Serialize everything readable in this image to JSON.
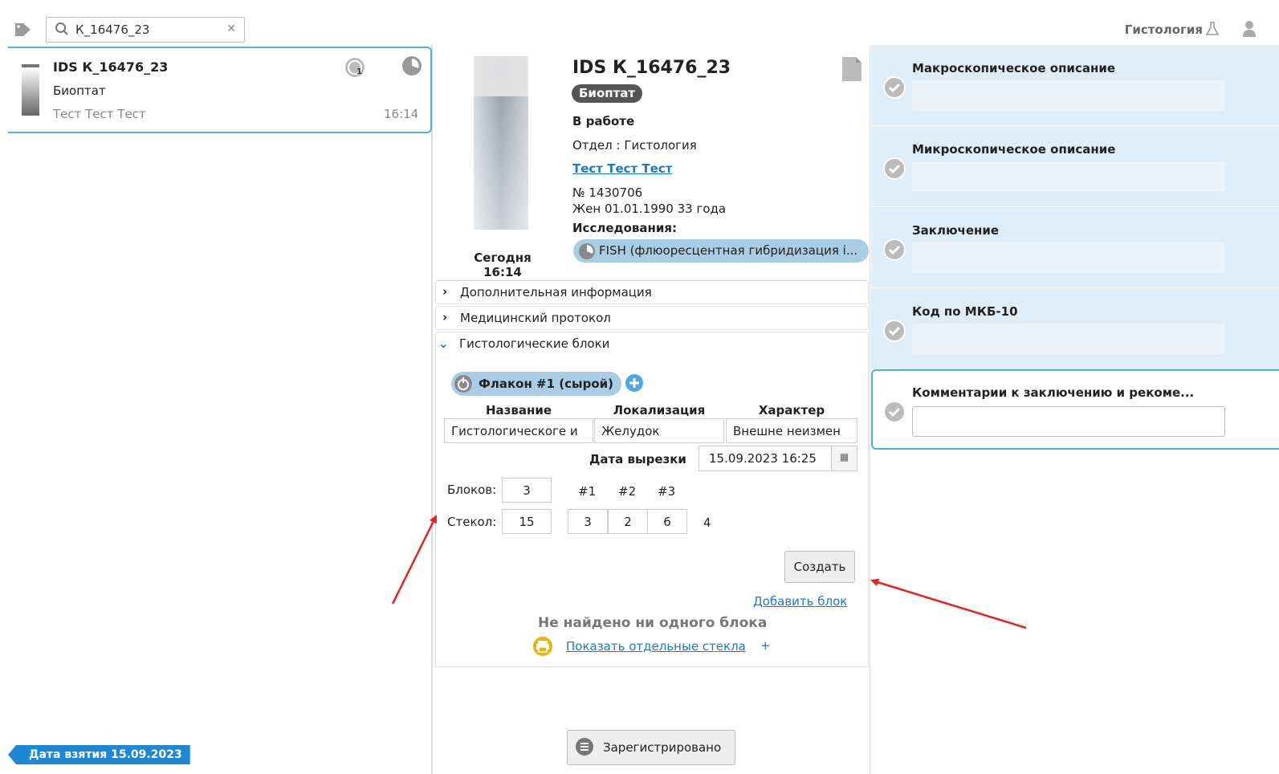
{
  "search": {
    "value": "К_16476_23"
  },
  "header": {
    "department": "Гистология"
  },
  "case_list": {
    "items": [
      {
        "title": "IDS К_16476_23",
        "type": "Биоптат",
        "patient": "Тест Тест Тест",
        "time": "16:14",
        "badge_count": "1"
      }
    ],
    "filter_tag": "Дата взятия 15.09.2023"
  },
  "detail": {
    "title": "IDS К_16476_23",
    "type": "Биоптат",
    "status": "В работе",
    "department": "Отдел : Гистология",
    "patient": "Тест Тест Тест",
    "number": "№ 1430706",
    "dob": "Жен 01.01.1990 33 года",
    "studies_label": "Исследования:",
    "study": "FISH (флюоресцентная гибридизация i...",
    "date_label": "Сегодня",
    "date_time": "16:14",
    "accordions": [
      "Дополнительная информация",
      "Медицинский протокол",
      "Гистологические блоки"
    ],
    "flacon": "Флакон #1 (сырой)",
    "table": {
      "headers": [
        "Название",
        "Локализация",
        "Характер"
      ],
      "row": [
        "Гистологическоге и",
        "Желудок",
        "Внешне неизмен"
      ]
    },
    "cut_label": "Дата вырезки",
    "cut_date": "15.09.2023 16:25",
    "blocks_label": "Блоков:",
    "blocks_value": "3",
    "slides_label": "Стекол:",
    "slides_value": "15",
    "block_cols": [
      "#1",
      "#2",
      "#3"
    ],
    "block_slides": [
      "3",
      "2",
      "6"
    ],
    "slides_remainder": "4",
    "create_label": "Создать",
    "add_block": "Добавить блок",
    "no_blocks": "Не найдено ни одного блока",
    "show_slides": "Показать отдельные стекла",
    "plus": "+",
    "registered": "Зарегистрировано"
  },
  "report": {
    "sections": [
      "Макроскопическое описание",
      "Микроскопическое описание",
      "Заключение",
      "Код по МКБ-10",
      "Комментарии к заключению и рекоме..."
    ]
  },
  "colors": {
    "accent": "#4fb0e0",
    "link": "#1a7bc9",
    "pill": "#a9cde4",
    "section_bg": "#deedf7",
    "annotation": "#e82020"
  }
}
